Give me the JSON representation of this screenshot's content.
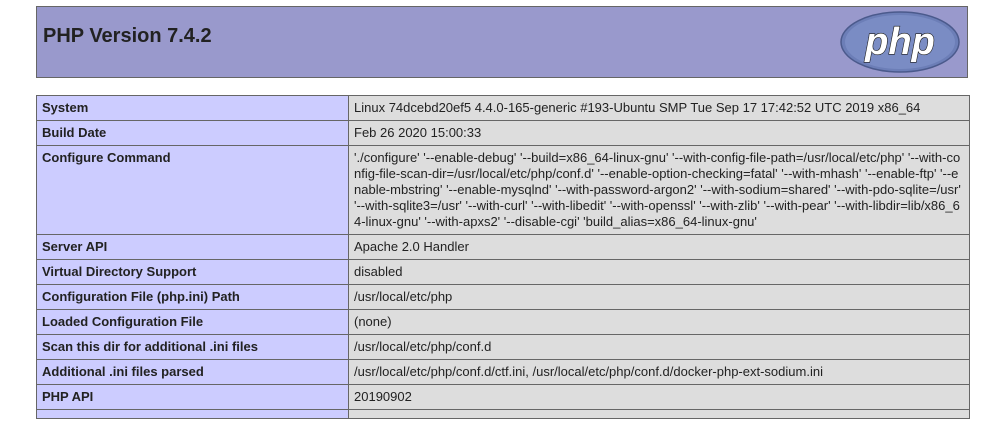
{
  "header": {
    "title": "PHP Version 7.4.2",
    "logo_text": "php"
  },
  "colors": {
    "header_bg": "#9999cc",
    "key_bg": "#ccccff",
    "value_bg": "#dddddd",
    "border": "#666666"
  },
  "rows": [
    {
      "key": "System",
      "value": "Linux 74dcebd20ef5 4.4.0-165-generic #193-Ubuntu SMP Tue Sep 17 17:42:52 UTC 2019 x86_64"
    },
    {
      "key": "Build Date",
      "value": "Feb 26 2020 15:00:33"
    },
    {
      "key": "Configure Command",
      "value": "'./configure' '--enable-debug' '--build=x86_64-linux-gnu' '--with-config-file-path=/usr/local/etc/php' '--with-config-file-scan-dir=/usr/local/etc/php/conf.d' '--enable-option-checking=fatal' '--with-mhash' '--enable-ftp' '--enable-mbstring' '--enable-mysqlnd' '--with-password-argon2' '--with-sodium=shared' '--with-pdo-sqlite=/usr' '--with-sqlite3=/usr' '--with-curl' '--with-libedit' '--with-openssl' '--with-zlib' '--with-pear' '--with-libdir=lib/x86_64-linux-gnu' '--with-apxs2' '--disable-cgi' 'build_alias=x86_64-linux-gnu'"
    },
    {
      "key": "Server API",
      "value": "Apache 2.0 Handler"
    },
    {
      "key": "Virtual Directory Support",
      "value": "disabled"
    },
    {
      "key": "Configuration File (php.ini) Path",
      "value": "/usr/local/etc/php"
    },
    {
      "key": "Loaded Configuration File",
      "value": "(none)"
    },
    {
      "key": "Scan this dir for additional .ini files",
      "value": "/usr/local/etc/php/conf.d"
    },
    {
      "key": "Additional .ini files parsed",
      "value": "/usr/local/etc/php/conf.d/ctf.ini, /usr/local/etc/php/conf.d/docker-php-ext-sodium.ini"
    },
    {
      "key": "PHP API",
      "value": "20190902"
    },
    {
      "key": "",
      "value": ""
    }
  ]
}
